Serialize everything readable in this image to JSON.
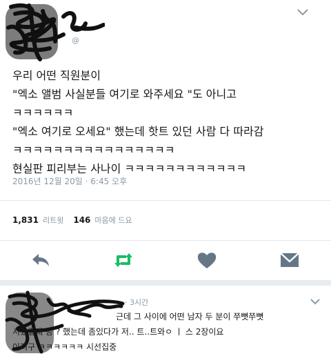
{
  "tweet": {
    "handle_partial": "@",
    "body_lines": [
      "우리 어떤 직원분이",
      "\"엑소 앨범 사실분들 여기로 와주세요 \"도 아니고",
      "ㅋㅋㅋㅋㅋㅋ",
      "\"엑소 여기로 오세요\" 했는데 핫트 있던 사람 다 따라감",
      "ㅋㅋㅋㅋㅋㅋㅋㅋㅋㅋㅋㅋㅋㅋㅋㅋ",
      "현실판 피리부는 사나이 ㅋㅋㅋㅋㅋㅋㅋㅋㅋㅋㅋㅋ"
    ],
    "timestamp": "2016년 12월 20일 · 6:45 오후",
    "retweet_count": "1,831",
    "retweet_label": "리트윗",
    "like_count": "146",
    "like_label": "마음에 드요"
  },
  "actions": {
    "reply_icon": "reply-icon",
    "retweet_icon": "retweet-icon",
    "like_icon": "heart-icon",
    "dm_icon": "envelope-icon",
    "accent_green": "#17bf63"
  },
  "reply": {
    "time": "· 3시간",
    "lines": [
      "근데 그 사이에 어떤 남자 두 분이 쭈뼛쭈뼛",
      "서있길래 응 ? 했는데 좀있다가 저.. 트..트와ㅇ ㅣ 스 2장이요",
      "이러구 ㅋㅋㅋㅋㅋㅋ 시선집중"
    ]
  }
}
